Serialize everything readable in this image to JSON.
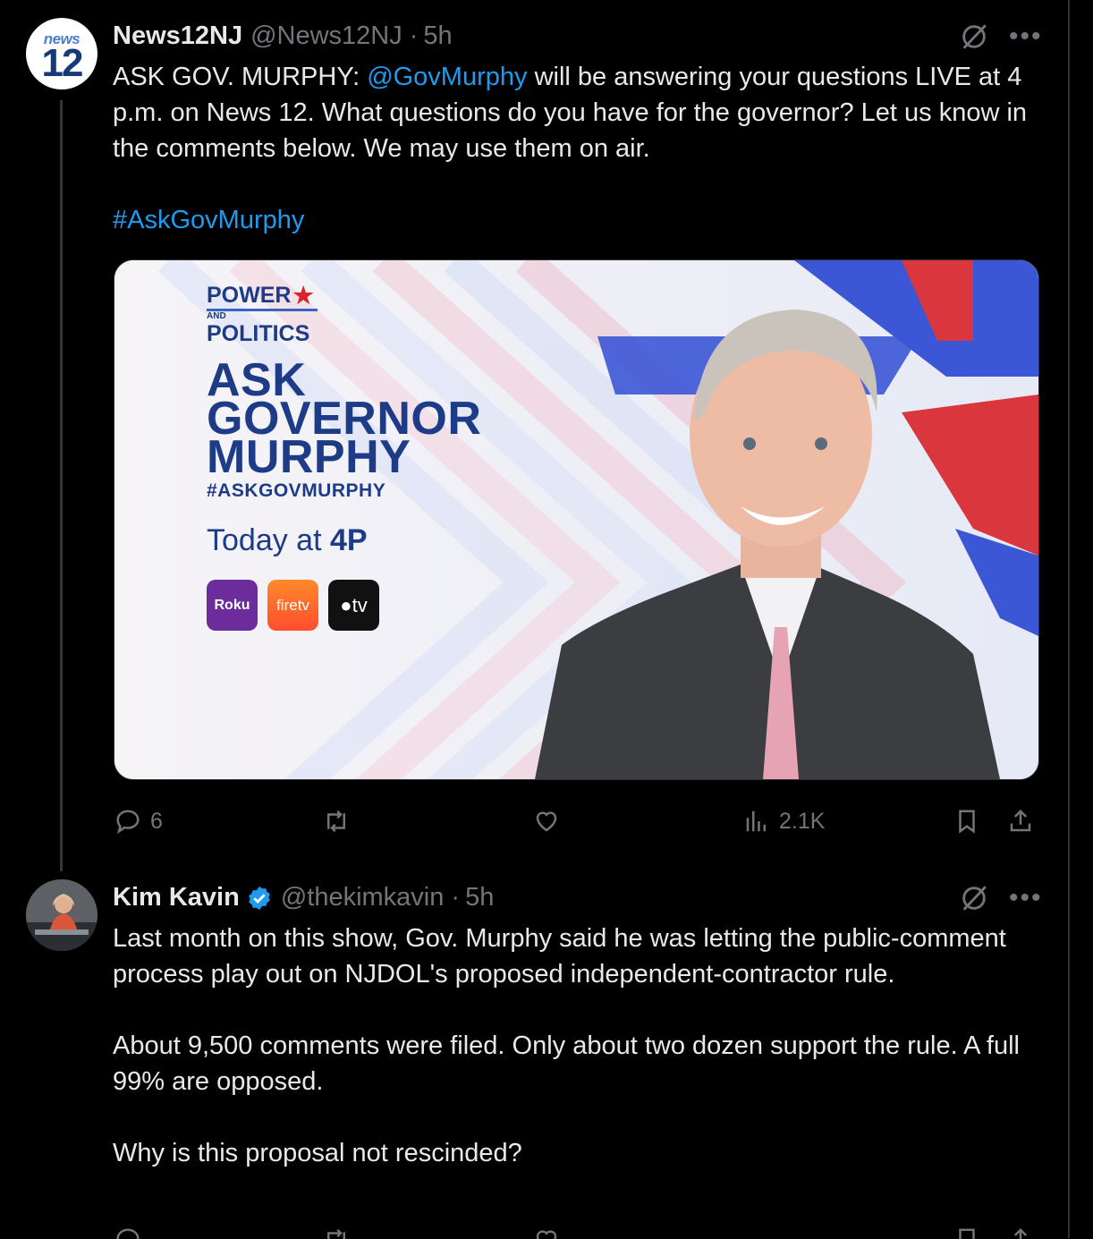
{
  "tweet1": {
    "display_name": "News12NJ",
    "handle": "@News12NJ",
    "time": "5h",
    "text_lead": "ASK GOV. MURPHY: ",
    "mention": "@GovMurphy",
    "text_rest": " will be answering your questions LIVE at 4 p.m. on News 12. What questions do you have for the governor? Let us know in the comments below. We may use them on air.",
    "hashtag": "#AskGovMurphy",
    "avatar": {
      "word": "news",
      "number": "12"
    },
    "media": {
      "brand_top": "POWER",
      "brand_and": "AND",
      "brand_bottom": "POLITICS",
      "title_line1": "ASK",
      "title_line2": "GOVERNOR",
      "title_line3": "MURPHY",
      "hashtag": "#ASKGOVMURPHY",
      "today_prefix": "Today at ",
      "today_time": "4P",
      "apps": [
        "Roku",
        "firetv",
        "tv"
      ]
    },
    "stats": {
      "replies": "6",
      "views": "2.1K"
    }
  },
  "tweet2": {
    "display_name": "Kim Kavin",
    "handle": "@thekimkavin",
    "time": "5h",
    "text": "Last month on this show, Gov. Murphy said he was letting the public-comment process play out on NJDOL's proposed independent-contractor rule.\n\nAbout 9,500 comments were filed. Only about two dozen support the rule. A full 99% are opposed.\n\nWhy is this proposal not rescinded?"
  },
  "separator": "·",
  "colors": {
    "background": "#000000",
    "text": "#e7e9ea",
    "muted": "#71767b",
    "accent": "#1d9bf0",
    "verified": "#1d9bf0"
  },
  "icons": [
    "grok-icon",
    "more-icon",
    "reply-icon",
    "retweet-icon",
    "like-icon",
    "views-icon",
    "bookmark-icon",
    "share-icon",
    "verified-badge-icon"
  ]
}
